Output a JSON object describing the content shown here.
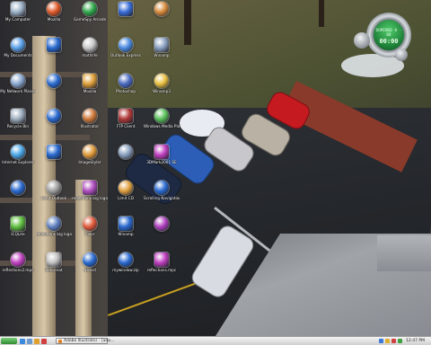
{
  "desktop": {
    "icons": [
      {
        "label": "My Computer",
        "icon": "computer-icon",
        "color": "#9fb4c8"
      },
      {
        "label": "Mozilla",
        "icon": "mozilla-icon",
        "color": "#e05a2a"
      },
      {
        "label": "GameSpy Arcade",
        "icon": "gamespy-icon",
        "color": "#2fa84a"
      },
      {
        "label": "",
        "icon": "app-icon",
        "color": "#3a6ed8"
      },
      {
        "label": "",
        "icon": "globe-icon",
        "color": "#d88a3a"
      },
      {
        "label": "My Documents",
        "icon": "documents-icon",
        "color": "#5aa0e8"
      },
      {
        "label": "",
        "icon": "app-icon",
        "color": "#2a6ad0"
      },
      {
        "label": "mathlife",
        "icon": "mathlife-icon",
        "color": "#c8c8c8"
      },
      {
        "label": "Outlook Express",
        "icon": "outlook-express-icon",
        "color": "#4a8ae0"
      },
      {
        "label": "Winamp",
        "icon": "winamp-icon",
        "color": "#8aa0c0"
      },
      {
        "label": "My Network Places",
        "icon": "network-icon",
        "color": "#8aa8d0"
      },
      {
        "label": "",
        "icon": "app-icon",
        "color": "#2a6ad0"
      },
      {
        "label": "Mozilla",
        "icon": "mozilla-icon",
        "color": "#e0a03a"
      },
      {
        "label": "Photoshop",
        "icon": "photoshop-icon",
        "color": "#4a6ac0"
      },
      {
        "label": "Winamp3",
        "icon": "winamp3-icon",
        "color": "#e8c040"
      },
      {
        "label": "Recycle Bin",
        "icon": "recycle-bin-icon",
        "color": "#a0b0c0"
      },
      {
        "label": "",
        "icon": "app-icon",
        "color": "#2a6ad0"
      },
      {
        "label": "Illustrator",
        "icon": "illustrator-icon",
        "color": "#d07a3a"
      },
      {
        "label": "FTP Client",
        "icon": "ftp-icon",
        "color": "#b03a3a"
      },
      {
        "label": "Windows Media Player",
        "icon": "media-player-icon",
        "color": "#5ac05a"
      },
      {
        "label": "Internet Explorer",
        "icon": "internet-explorer-icon",
        "color": "#4aa8e8"
      },
      {
        "label": "",
        "icon": "app-icon",
        "color": "#2a6ad0"
      },
      {
        "label": "ImageStyler",
        "icon": "imagestyler-icon",
        "color": "#e09a3a"
      },
      {
        "label": "",
        "icon": "app-icon",
        "color": "#8aa0c0"
      },
      {
        "label": "3DMark2001 SE",
        "icon": "3dmark-icon",
        "color": "#c040c0"
      },
      {
        "label": "",
        "icon": "app-icon",
        "color": "#2a6ad0"
      },
      {
        "label": "Limit Outlook",
        "icon": "outlook-icon",
        "color": "#a0a0a0"
      },
      {
        "label": "reflections big logo glass.html",
        "icon": "html-file-icon",
        "color": "#b050c0"
      },
      {
        "label": "Limit CD",
        "icon": "cd-icon",
        "color": "#e0a040"
      },
      {
        "label": "Scrolling Navigation",
        "icon": "navigation-icon",
        "color": "#2a6ad0"
      },
      {
        "label": "ICQLite",
        "icon": "icq-icon",
        "color": "#60c040"
      },
      {
        "label": "reflections big logo glass.psd",
        "icon": "psd-file-icon",
        "color": "#6080c0"
      },
      {
        "label": "Color",
        "icon": "color-icon",
        "color": "#e05a3a"
      },
      {
        "label": "Winamp",
        "icon": "winamp-icon",
        "color": "#2a6ad0"
      },
      {
        "label": "",
        "icon": "app-icon",
        "color": "#b040c0"
      },
      {
        "label": "reflections2.mpc",
        "icon": "mpc-file-icon",
        "color": "#c040c0"
      },
      {
        "label": "Reformat",
        "icon": "reformat-icon",
        "color": "#c0c0c0"
      },
      {
        "label": "wizard",
        "icon": "wizard-icon",
        "color": "#2a6ad0"
      },
      {
        "label": "mywindow.zip",
        "icon": "zip-file-icon",
        "color": "#2a6ad0"
      },
      {
        "label": "reflections.mpc",
        "icon": "mpc-file-icon",
        "color": "#c040c0"
      }
    ]
  },
  "clock": {
    "date_text": "DOMINGO 8 - 08",
    "time_text": "00:00",
    "accent": "#3ac060"
  },
  "taskbar": {
    "start_icon": "start-icon",
    "task_item_label": "Adobe Illustrator - [ado...",
    "tray_time": "12:47 PM"
  }
}
